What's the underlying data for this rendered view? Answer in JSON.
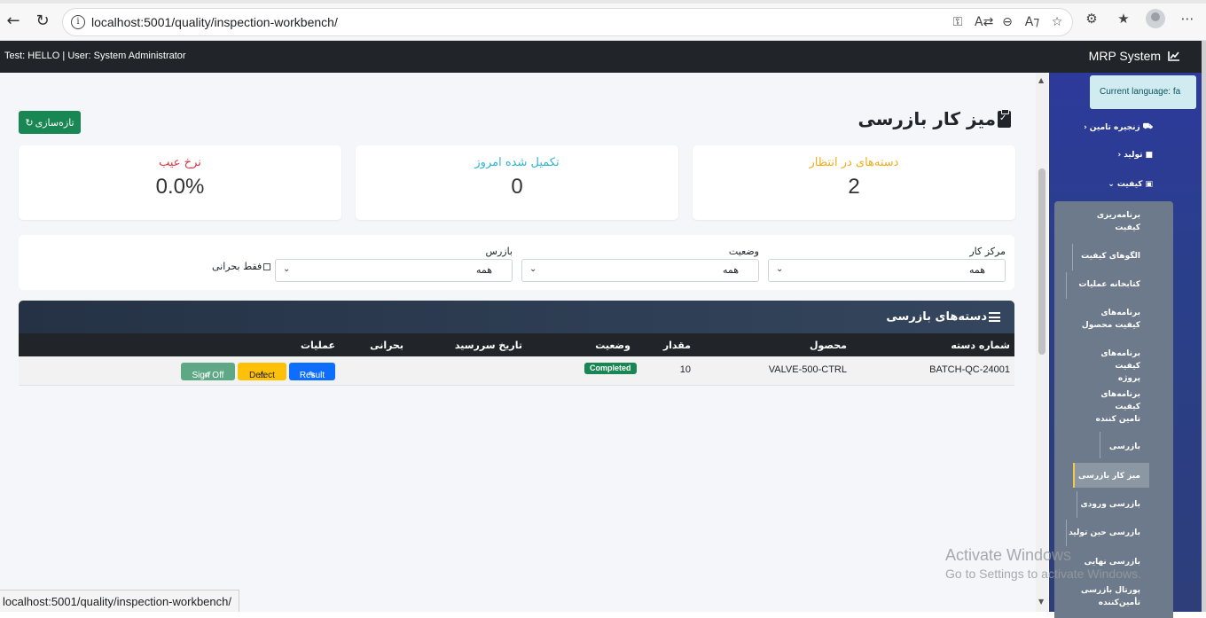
{
  "browser": {
    "url": "localhost:5001/quality/inspection-workbench/"
  },
  "topnav": {
    "user_text": "Test: HELLO | User: System Administrator",
    "brand": "MRP System"
  },
  "page": {
    "title": "میز کار بازرسی",
    "refresh_label": "تازه‌سازی"
  },
  "stats": {
    "pending": {
      "label": "دسته‌های در انتظار",
      "value": "2",
      "color": "#f0ad1c"
    },
    "completed_today": {
      "label": "تکمیل شده امروز",
      "value": "0",
      "color": "#2fb6d0"
    },
    "defect_rate": {
      "label": "نرخ عیب",
      "value": "0.0%",
      "color": "#dc3545"
    }
  },
  "filters": {
    "work_center": {
      "label": "مرکز کار",
      "value": "همه"
    },
    "status": {
      "label": "وضعیت",
      "value": "همه"
    },
    "inspector": {
      "label": "بازرس",
      "value": "همه"
    },
    "critical_only": "فقط بحرانی"
  },
  "table": {
    "title": "دسته‌های بازرسی",
    "columns": {
      "batch": "شماره دسته",
      "product": "محصول",
      "quantity": "مقدار",
      "status": "وضعیت",
      "due_date": "تاریخ سررسید",
      "critical": "بحرانی",
      "actions": "عملیات"
    },
    "rows": [
      {
        "batch": "BATCH-QC-24001",
        "product": "VALVE-500-CTRL",
        "quantity": "10",
        "status": "Completed",
        "due_date": "",
        "critical": "",
        "actions": {
          "result": "Result",
          "defect": "Defect",
          "sign_off": "Sign Off"
        }
      }
    ]
  },
  "sidebar": {
    "language": "Current language: fa",
    "sections": {
      "supply_chain": "زنجیره تامین",
      "production": "تولید",
      "quality": "کیفیت"
    },
    "quality_items": {
      "quality_planning": "برنامه‌ریزی کیفیت",
      "quality_templates": "الگوهای کیفیت",
      "operations_library": "کتابخانه عملیات",
      "product_quality_plans": "برنامه‌های کیفیت محصول",
      "project_quality_plans": "برنامه‌های کیفیت پروژه",
      "supplier_quality_plans": "برنامه‌های کیفیت تامین کننده",
      "inspection": "بازرسی",
      "inspection_workbench": "میز کار بازرسی",
      "incoming_inspection": "بازرسی ورودی",
      "in_process_inspection": "بازرسی حین تولید",
      "final_inspection": "بازرسی نهایی",
      "supplier_inspection_portal": "پورتال بازرسی تأمین‌کننده"
    }
  },
  "os": {
    "watermark_title": "Activate Windows",
    "watermark_sub": "Go to Settings to activate Windows."
  }
}
